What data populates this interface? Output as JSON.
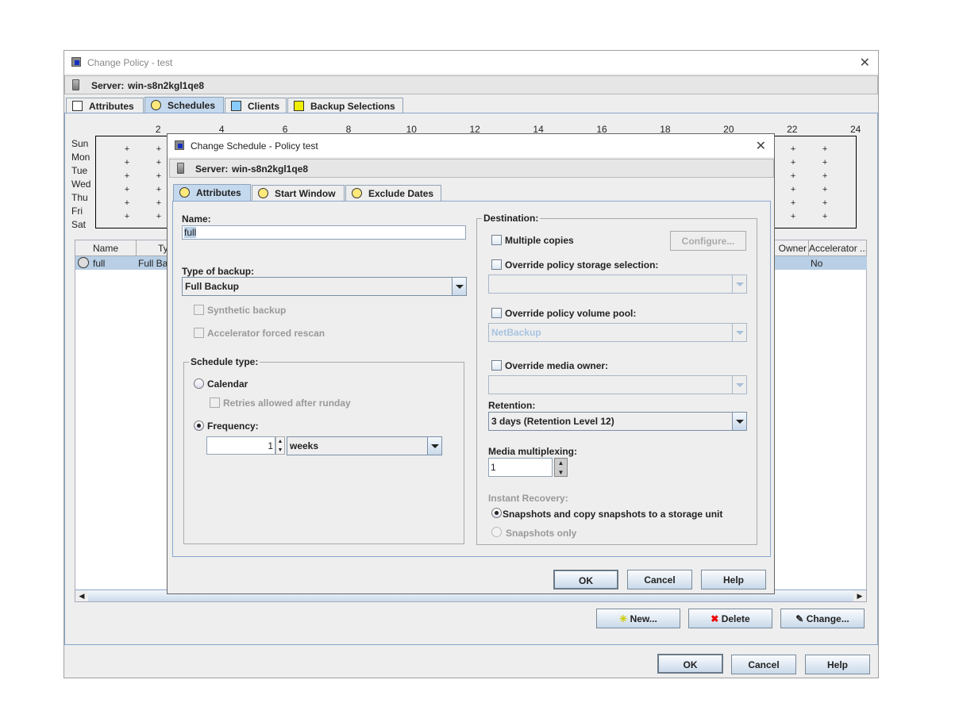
{
  "policy_window": {
    "title": "Change Policy - test",
    "server_label": "Server:",
    "server_name": "win-s8n2kgl1qe8",
    "tabs": [
      {
        "label": "Attributes"
      },
      {
        "label": "Schedules",
        "selected": true
      },
      {
        "label": "Clients"
      },
      {
        "label": "Backup Selections"
      }
    ],
    "schedule_grid": {
      "hours": [
        "2",
        "4",
        "6",
        "8",
        "10",
        "12",
        "14",
        "16",
        "18",
        "20",
        "22",
        "24"
      ],
      "days": [
        "Sun",
        "Mon",
        "Tue",
        "Wed",
        "Thu",
        "Fri",
        "Sat"
      ]
    },
    "table": {
      "columns": [
        "Name",
        "Typ",
        "Owner",
        "Accelerator ..."
      ],
      "rows": [
        {
          "name": "full",
          "type": "Full Ba",
          "accelerator": "No"
        }
      ]
    },
    "buttons": {
      "new": "New...",
      "delete": "Delete",
      "change": "Change...",
      "ok": "OK",
      "cancel": "Cancel",
      "help": "Help"
    }
  },
  "dialog": {
    "title": "Change Schedule - Policy test",
    "server_label": "Server:",
    "server_name": "win-s8n2kgl1qe8",
    "tabs": [
      {
        "label": "Attributes",
        "selected": true
      },
      {
        "label": "Start Window"
      },
      {
        "label": "Exclude Dates"
      }
    ],
    "name_label": "Name:",
    "name_value": "full",
    "type_label": "Type of backup:",
    "type_value": "Full Backup",
    "synthetic": "Synthetic backup",
    "accel_rescan": "Accelerator forced rescan",
    "schedule_type": {
      "label": "Schedule type:",
      "calendar": "Calendar",
      "retries": "Retries allowed after runday",
      "frequency": "Frequency:",
      "freq_value": "1",
      "freq_unit": "weeks",
      "selected": "frequency"
    },
    "destination": {
      "label": "Destination:",
      "multiple_copies": "Multiple copies",
      "configure": "Configure...",
      "override_storage": "Override policy storage selection:",
      "override_pool": "Override policy volume pool:",
      "pool_value": "NetBackup",
      "override_owner": "Override media owner:",
      "retention_label": "Retention:",
      "retention_value": "3 days (Retention Level 12)",
      "multiplexing_label": "Media multiplexing:",
      "multiplexing_value": "1",
      "instant_recovery": "Instant Recovery:",
      "ir_option1": "Snapshots and copy snapshots to a storage unit",
      "ir_option2": "Snapshots only"
    },
    "buttons": {
      "ok": "OK",
      "cancel": "Cancel",
      "help": "Help"
    }
  }
}
